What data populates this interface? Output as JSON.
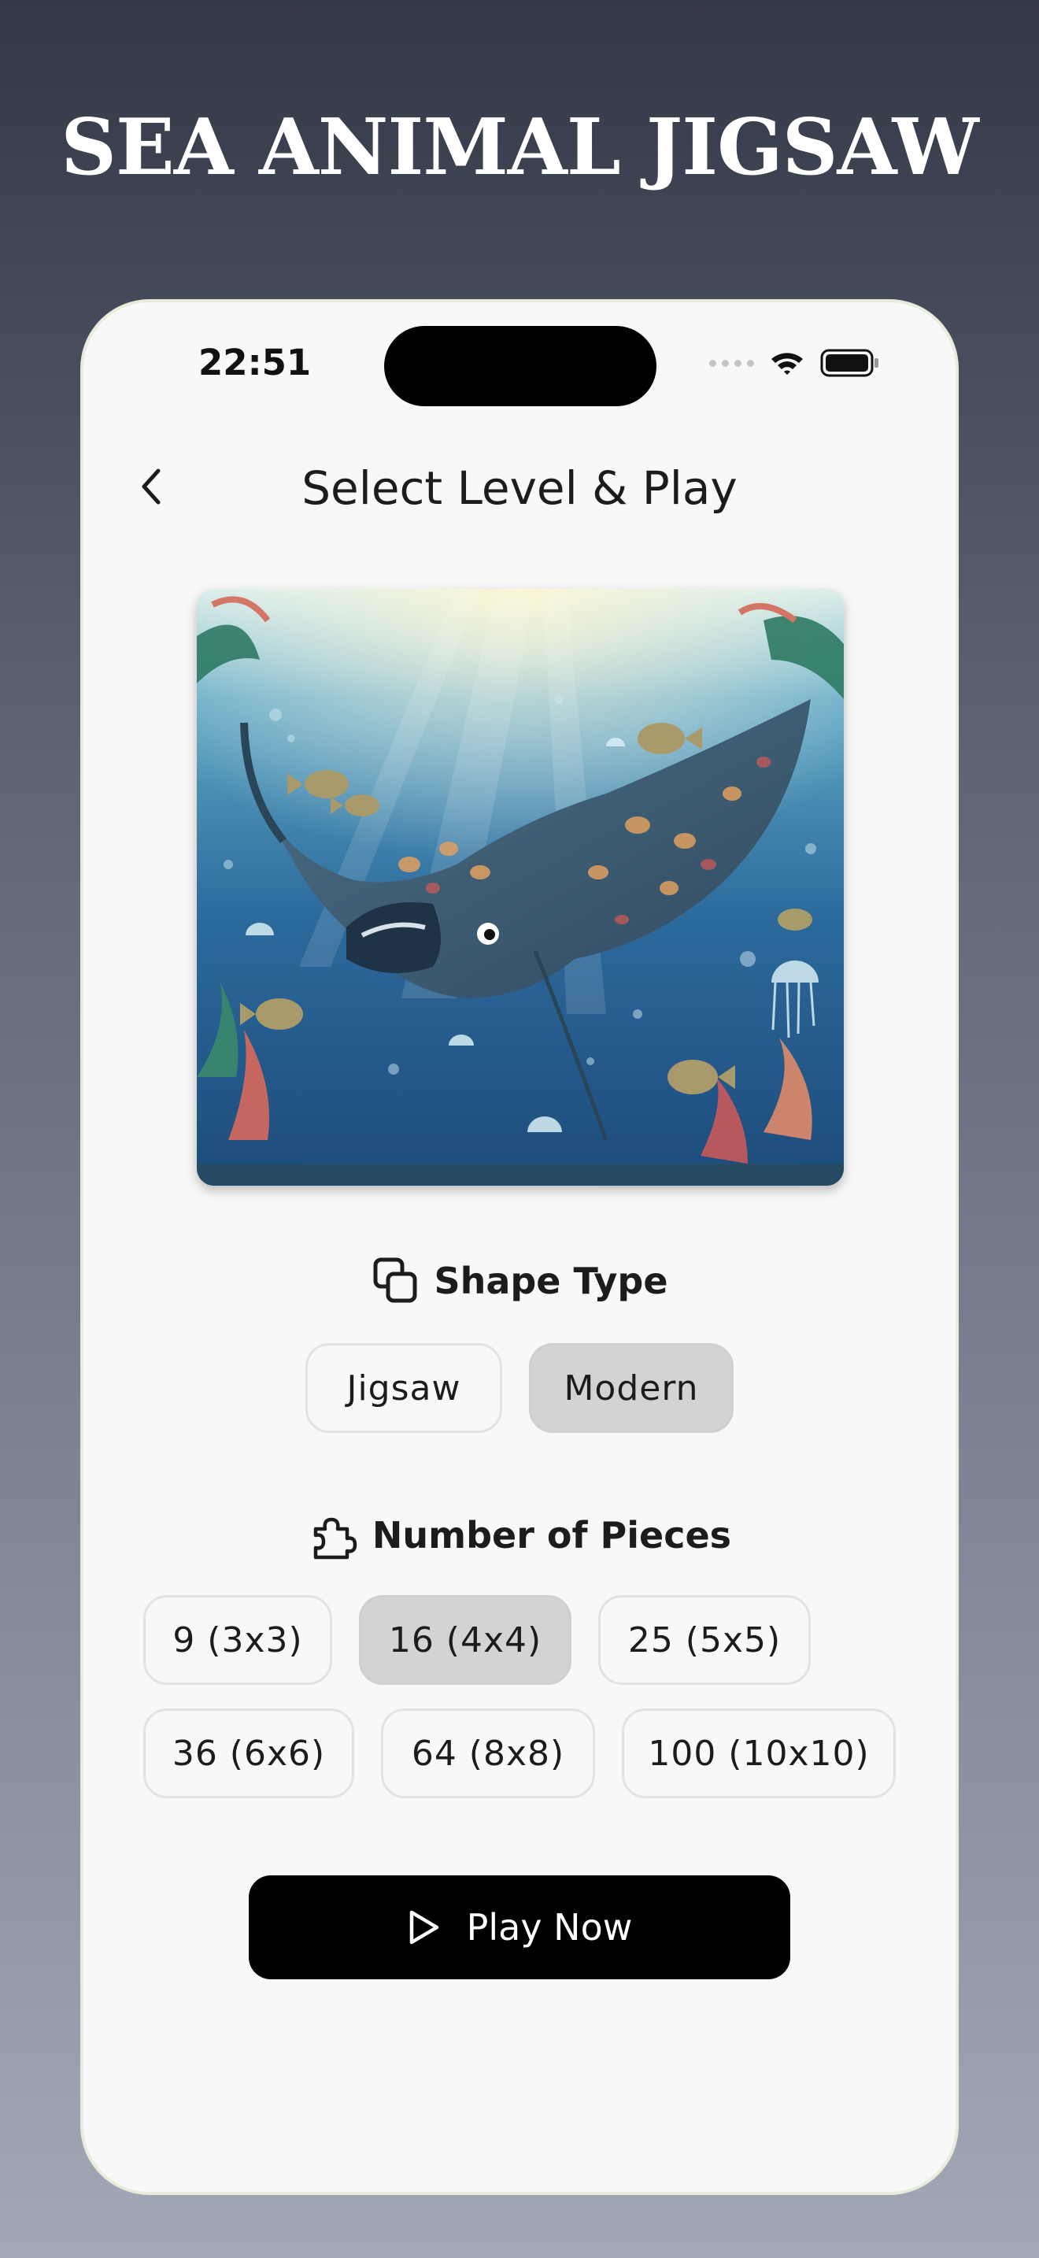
{
  "promo": {
    "title": "SEA ANIMAL JIGSAW"
  },
  "status_bar": {
    "time": "22:51",
    "icons": [
      "signal-dots-icon",
      "wifi-icon",
      "battery-icon"
    ]
  },
  "header": {
    "title": "Select Level & Play",
    "back_icon": "chevron-left-icon"
  },
  "preview": {
    "subject": "manta ray underwater illustration"
  },
  "shape_type": {
    "label": "Shape Type",
    "icon": "shapes-icon",
    "options": [
      {
        "label": "Jigsaw",
        "selected": false
      },
      {
        "label": "Modern",
        "selected": true
      }
    ]
  },
  "pieces": {
    "label": "Number of Pieces",
    "icon": "puzzle-piece-icon",
    "options": [
      {
        "label": "9 (3x3)",
        "selected": false
      },
      {
        "label": "16 (4x4)",
        "selected": true
      },
      {
        "label": "25 (5x5)",
        "selected": false
      },
      {
        "label": "36 (6x6)",
        "selected": false
      },
      {
        "label": "64 (8x8)",
        "selected": false
      },
      {
        "label": "100 (10x10)",
        "selected": false
      }
    ]
  },
  "play": {
    "label": "Play Now",
    "icon": "play-icon"
  },
  "colors": {
    "accent": "#000000",
    "selected_chip": "#d3d3d3",
    "card": "#f8f8f8"
  }
}
